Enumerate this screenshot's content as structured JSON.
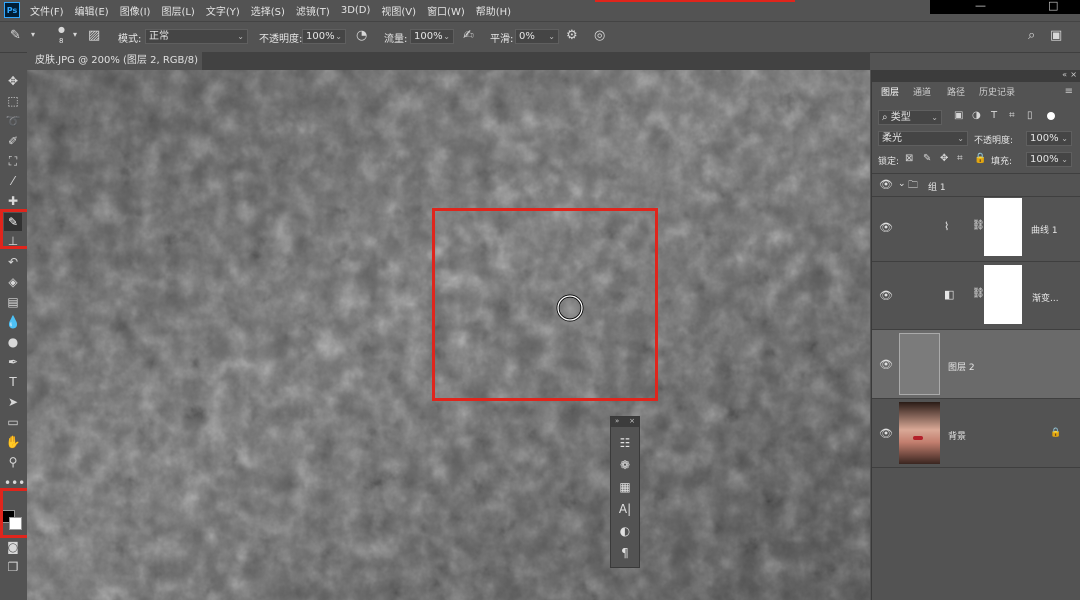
{
  "app": {
    "logo": "Ps"
  },
  "menu": [
    "文件(F)",
    "编辑(E)",
    "图像(I)",
    "图层(L)",
    "文字(Y)",
    "选择(S)",
    "滤镜(T)",
    "3D(D)",
    "视图(V)",
    "窗口(W)",
    "帮助(H)"
  ],
  "window_controls": {
    "minimize": "—",
    "maximize": "□"
  },
  "options_bar": {
    "brush_size": "8",
    "mode_label": "模式:",
    "mode_value": "正常",
    "opacity_label": "不透明度:",
    "opacity_value": "100%",
    "flow_label": "流量:",
    "flow_value": "100%",
    "smoothing_label": "平滑:",
    "smoothing_value": "0%"
  },
  "document_tab": {
    "title": "皮肤.JPG @ 200% (图层 2, RGB/8) *",
    "close": "×"
  },
  "layers_panel": {
    "tabs": [
      "图层",
      "通道",
      "路径",
      "历史记录"
    ],
    "filter_kind": "类型",
    "blend_mode": "柔光",
    "opacity_label": "不透明度:",
    "opacity_value": "100%",
    "lock_label": "锁定:",
    "fill_label": "填充:",
    "fill_value": "100%",
    "layers": [
      {
        "name": "组 1",
        "type": "group"
      },
      {
        "name": "曲线 1",
        "type": "adjustment-curves"
      },
      {
        "name": "渐变...",
        "type": "adjustment-gradient"
      },
      {
        "name": "图层 2",
        "type": "pixel",
        "selected": true
      },
      {
        "name": "背景",
        "type": "background",
        "locked": true
      }
    ]
  },
  "colors": {
    "highlight_red": "#e0251c",
    "canvas_gray": "#6e6e6e",
    "ui_gray": "#535353"
  }
}
